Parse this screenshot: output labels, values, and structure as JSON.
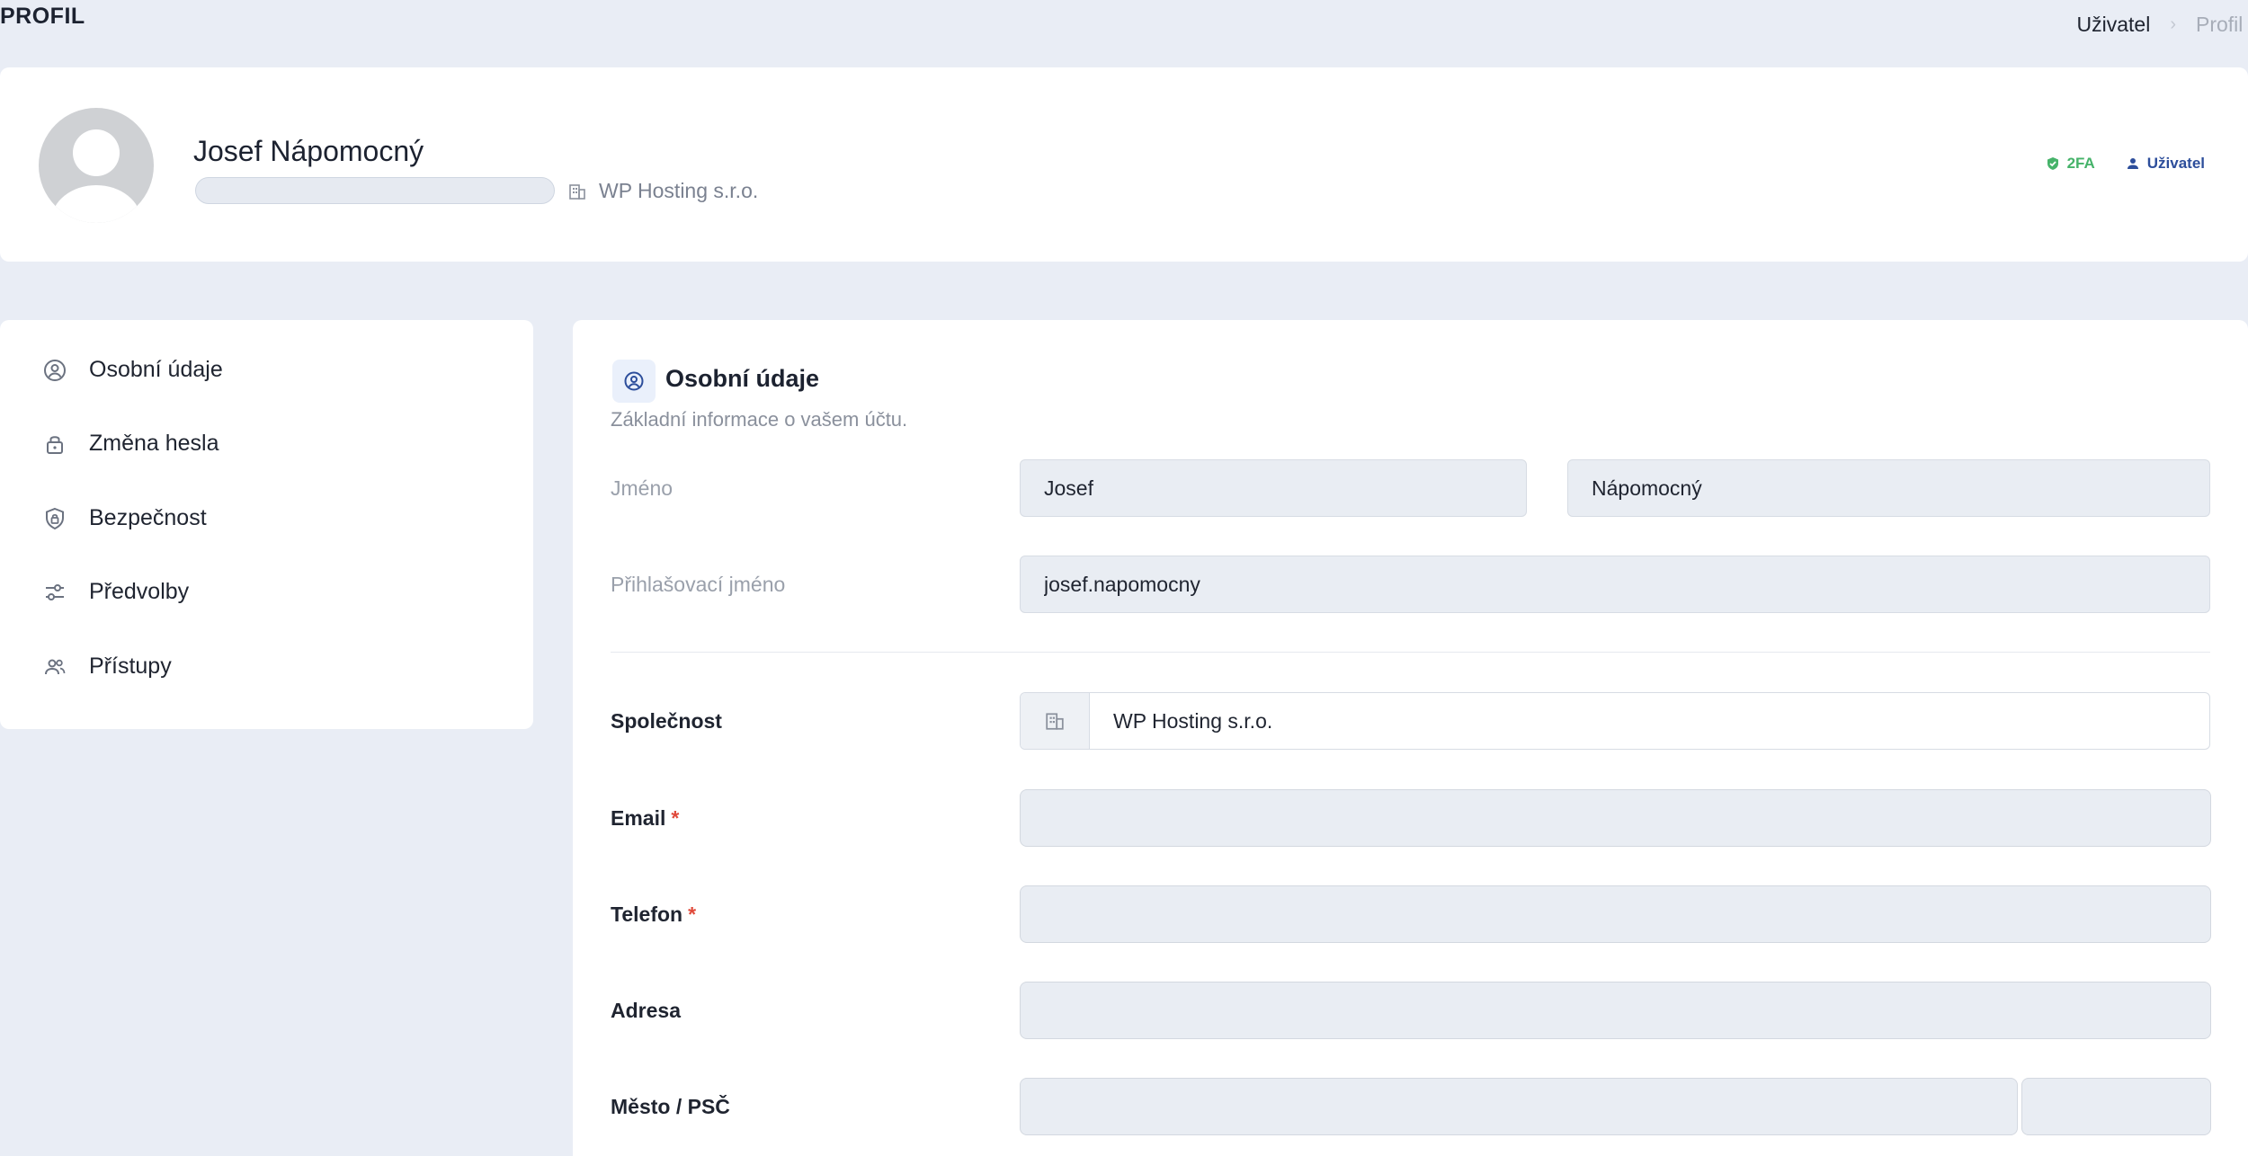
{
  "page": {
    "title": "PROFIL",
    "breadcrumb": [
      "Uživatel",
      "Profil"
    ]
  },
  "profile": {
    "name": "Josef Nápomocný",
    "company": "WP Hosting s.r.o.",
    "badges": {
      "twofa": "2FA",
      "role": "Uživatel"
    }
  },
  "sidebar": {
    "items": [
      {
        "label": "Osobní údaje",
        "icon": "user-circle-icon"
      },
      {
        "label": "Změna hesla",
        "icon": "lock-icon"
      },
      {
        "label": "Bezpečnost",
        "icon": "shield-icon"
      },
      {
        "label": "Předvolby",
        "icon": "sliders-icon"
      },
      {
        "label": "Přístupy",
        "icon": "users-icon"
      }
    ]
  },
  "section": {
    "title": "Osobní údaje",
    "subtitle": "Základní informace o vašem účtu."
  },
  "form": {
    "name_label": "Jméno",
    "first_name": "Josef",
    "last_name": "Nápomocný",
    "login_label": "Přihlašovací jméno",
    "login": "josef.napomocny",
    "company_label": "Společnost",
    "company": "WP Hosting s.r.o.",
    "email_label": "Email",
    "phone_label": "Telefon",
    "address_label": "Adresa",
    "city_label": "Město / PSČ",
    "required_mark": "*"
  },
  "colors": {
    "background": "#e9edf5",
    "accent": "#2d4e9b",
    "success": "#46b36a",
    "required": "#e0493a"
  }
}
